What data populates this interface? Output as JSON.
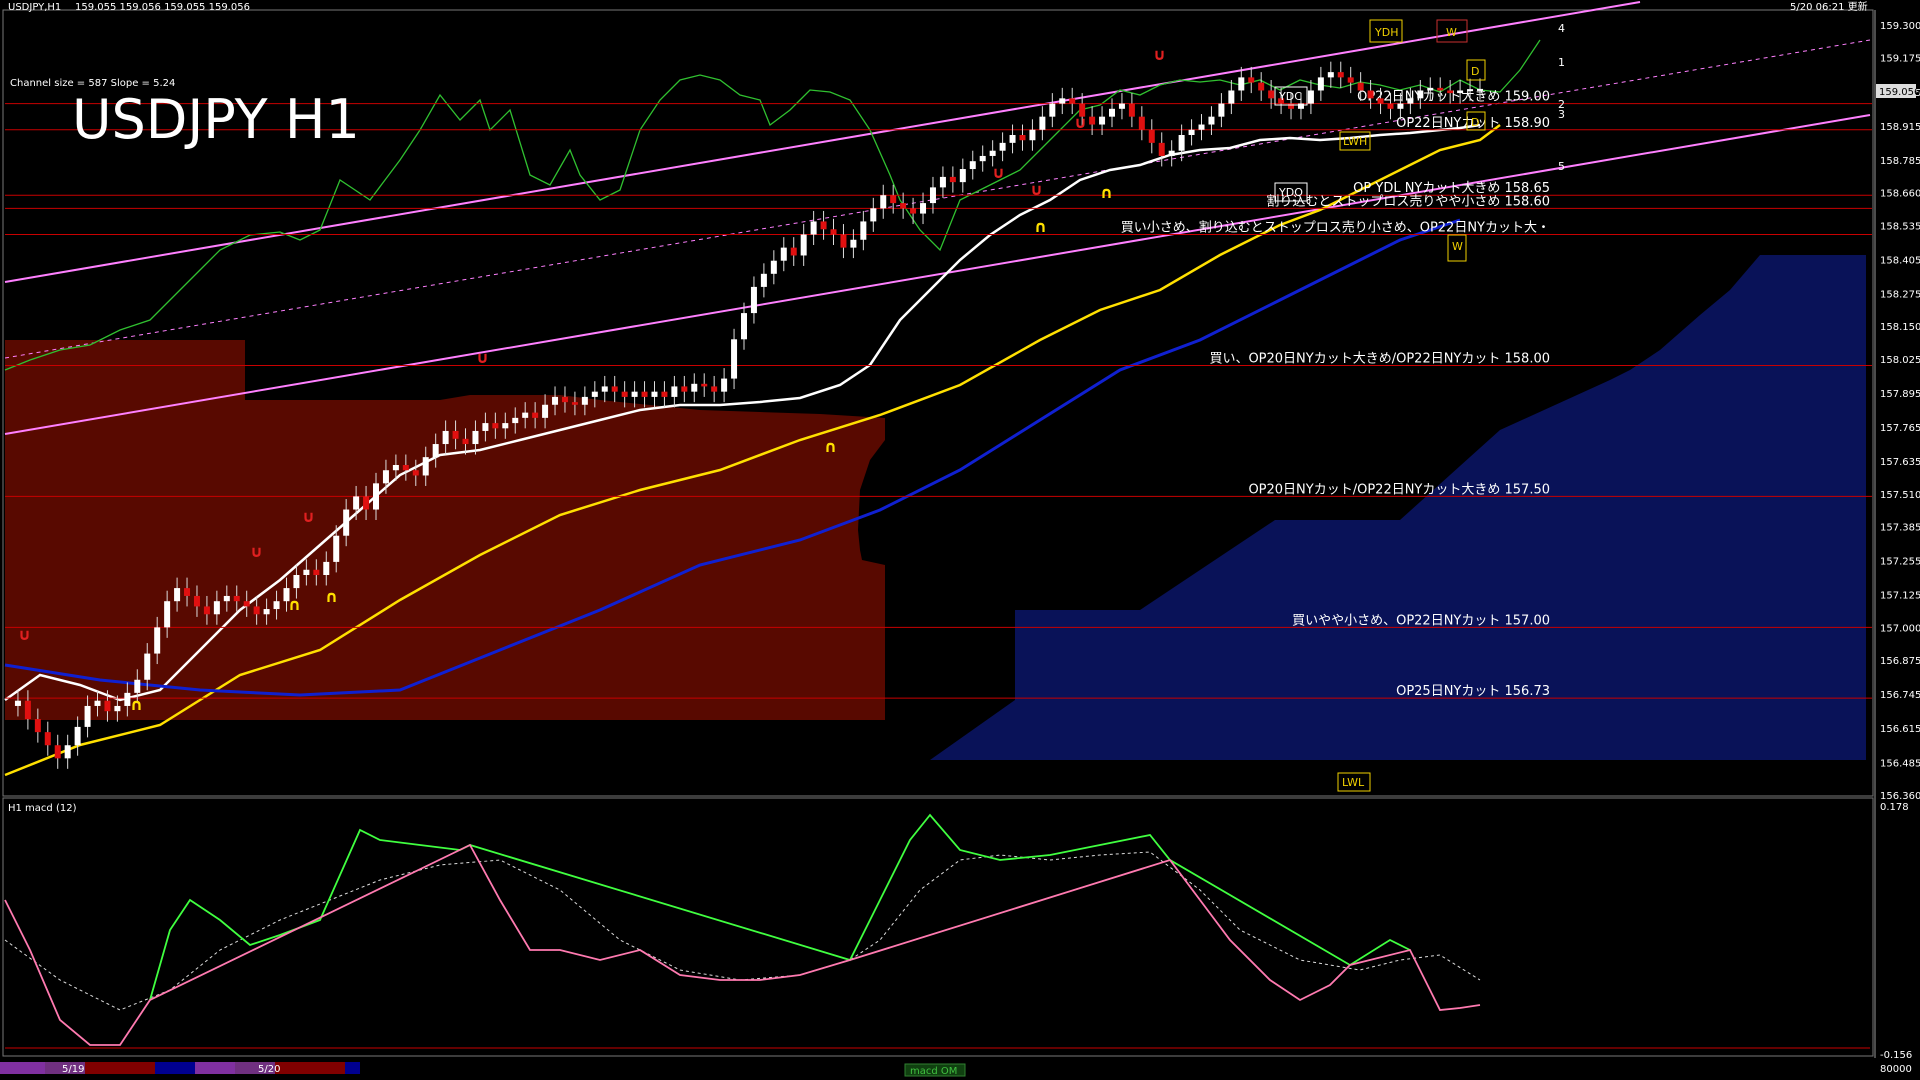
{
  "header": {
    "symbol_info": "USDJPY,H1",
    "ohlc": "159.055 159.056 159.055 159.056",
    "datetime": "5/20 06:21 更新"
  },
  "overlay": {
    "channel_info": "Channel size = 587 Slope = 5.24",
    "big_title": "USDJPY H1"
  },
  "lower_pane": {
    "label": "H1  macd (12)",
    "scale_top": "0.178",
    "scale_bottom": "-0.156",
    "scale_extra": "80000"
  },
  "bottom_bar": {
    "date_labels": [
      "5/19",
      "5/20"
    ],
    "indicator_tab": "macd OM"
  },
  "price_axis": {
    "labels": [
      "159.300",
      "159.175",
      "159.045",
      "158.915",
      "158.785",
      "158.660",
      "158.535",
      "158.405",
      "158.275",
      "158.150",
      "158.025",
      "157.895",
      "157.765",
      "157.635",
      "157.510",
      "157.385",
      "157.255",
      "157.125",
      "157.000",
      "156.875",
      "156.745",
      "156.615",
      "156.485",
      "156.360"
    ],
    "current_price": "159.056"
  },
  "levels": [
    {
      "price": 159.0,
      "text": "OP22日NYカット大きめ 159.00"
    },
    {
      "price": 158.9,
      "text": "OP22日NYカット 158.90"
    },
    {
      "price": 158.65,
      "text": "OP YDL NYカット大きめ 158.65"
    },
    {
      "price": 158.6,
      "text": "割り込むとストップロス売りやや小さめ 158.60"
    },
    {
      "price": 158.5,
      "text": "買い小さめ、割り込むとストップロス売り小さめ、OP22日NYカット大・"
    },
    {
      "price": 158.0,
      "text": "買い、OP20日NYカット大きめ/OP22日NYカット 158.00"
    },
    {
      "price": 157.5,
      "text": "OP20日NYカット/OP22日NYカット大きめ 157.50"
    },
    {
      "price": 157.0,
      "text": "買いやや小さめ、OP22日NYカット 157.00"
    },
    {
      "price": 156.73,
      "text": "OP25日NYカット 156.73"
    }
  ],
  "channel_labels": [
    "4",
    "1",
    "2",
    "3",
    "5"
  ],
  "tags": {
    "ydh": "YDH",
    "ydc": "YDC",
    "ydo": "YDO",
    "lwh": "LWH",
    "lwl": "LWL",
    "d": "D",
    "w": "W"
  },
  "colors": {
    "background": "#000000",
    "level_line": "#c80000",
    "channel": "#ff80ff",
    "rsi": "#30c030",
    "ma_white": "#ffffff",
    "ma_yellow": "#ffe000",
    "ma_blue": "#1020d0",
    "cloud_red": "#a01000",
    "cloud_blue": "#1020a0",
    "macd_up": "#40ff40",
    "macd_down": "#ff7ab0"
  },
  "chart_data": {
    "type": "line",
    "title": "USDJPY H1",
    "ylim": [
      156.36,
      159.3
    ],
    "x": [
      0,
      1,
      2,
      3,
      4,
      5,
      6,
      7,
      8,
      9,
      10,
      11,
      12,
      13,
      14,
      15,
      16,
      17,
      18,
      19,
      20,
      21,
      22,
      23,
      24,
      25,
      26,
      27,
      28,
      29,
      30,
      31,
      32,
      33,
      34,
      35,
      36,
      37,
      38,
      39,
      40,
      41,
      42,
      43,
      44,
      45,
      46,
      47,
      48,
      49,
      50,
      51,
      52,
      53,
      54,
      55,
      56,
      57,
      58,
      59,
      60,
      61,
      62,
      63,
      64,
      65,
      66,
      67,
      68,
      69,
      70,
      71,
      72,
      73,
      74,
      75,
      76,
      77,
      78,
      79,
      80,
      81,
      82,
      83,
      84,
      85,
      86,
      87,
      88,
      89,
      90,
      91,
      92,
      93,
      94,
      95,
      96,
      97,
      98,
      99,
      100,
      101,
      102,
      103,
      104,
      105,
      106,
      107,
      108,
      109,
      110,
      111,
      112,
      113,
      114,
      115,
      116,
      117,
      118,
      119,
      120,
      121,
      122,
      123,
      124,
      125,
      126,
      127,
      128,
      129,
      130,
      131,
      132,
      133,
      134,
      135,
      136,
      137,
      138,
      139,
      140,
      141,
      142,
      143,
      144,
      145,
      146,
      147,
      148
    ],
    "series": [
      {
        "values": [
          156.7,
          156.72,
          156.65,
          156.6,
          156.55,
          156.5,
          156.55,
          156.62,
          156.7,
          156.72,
          156.68,
          156.7,
          156.75,
          156.8,
          156.9,
          157.0,
          157.1,
          157.15,
          157.12,
          157.08,
          157.05,
          157.1,
          157.12,
          157.1,
          157.08,
          157.05,
          157.07,
          157.1,
          157.15,
          157.2,
          157.22,
          157.2,
          157.25,
          157.35,
          157.45,
          157.5,
          157.45,
          157.55,
          157.6,
          157.62,
          157.6,
          157.58,
          157.65,
          157.7,
          157.75,
          157.72,
          157.7,
          157.75,
          157.78,
          157.76,
          157.78,
          157.8,
          157.82,
          157.8,
          157.85,
          157.88,
          157.86,
          157.85,
          157.88,
          157.9,
          157.92,
          157.9,
          157.88,
          157.9,
          157.88,
          157.9,
          157.88,
          157.92,
          157.9,
          157.93,
          157.92,
          157.9,
          157.95,
          158.1,
          158.2,
          158.3,
          158.35,
          158.4,
          158.45,
          158.42,
          158.5,
          158.55,
          158.52,
          158.5,
          158.45,
          158.48,
          158.55,
          158.6,
          158.65,
          158.62,
          158.6,
          158.58,
          158.62,
          158.68,
          158.72,
          158.7,
          158.75,
          158.78,
          158.8,
          158.82,
          158.85,
          158.88,
          158.86,
          158.9,
          158.95,
          159.0,
          159.02,
          159.0,
          158.95,
          158.92,
          158.95,
          158.98,
          159.0,
          158.95,
          158.9,
          158.85,
          158.8,
          158.82,
          158.88,
          158.9,
          158.92,
          158.95,
          159.0,
          159.05,
          159.1,
          159.08,
          159.05,
          159.02,
          159.0,
          158.98,
          159.0,
          159.05,
          159.1,
          159.12,
          159.1,
          159.08,
          159.05,
          159.02,
          159.0,
          158.98,
          159.0,
          159.02,
          159.05,
          159.06,
          159.05,
          159.04,
          159.05,
          159.055,
          159.056
        ]
      }
    ]
  }
}
